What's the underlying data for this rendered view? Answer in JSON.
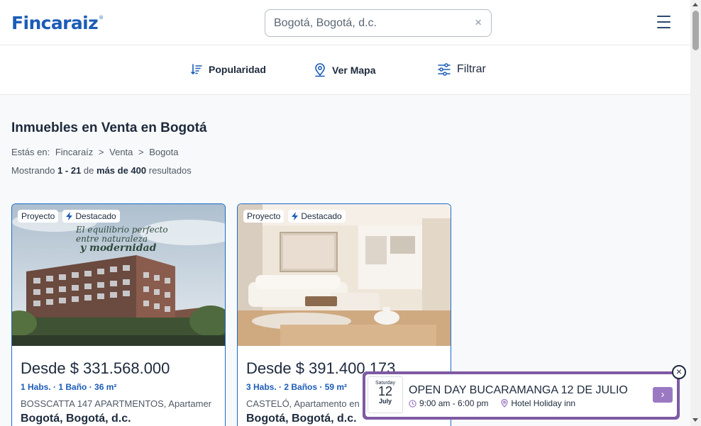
{
  "header": {
    "logo": "Fincaraiz",
    "logo_mark": "®",
    "search_value": "Bogotá, Bogotá, d.c.",
    "clear_glyph": "×"
  },
  "toolbar": {
    "popularity": "Popularidad",
    "map": "Ver Mapa",
    "filter": "Filtrar"
  },
  "main": {
    "title": "Inmuebles en Venta en Bogotá",
    "breadcrumb": {
      "prefix": "Estás en:",
      "items": [
        "Fincaraíz",
        ">",
        "Venta",
        ">",
        "Bogota"
      ]
    },
    "results": {
      "prefix": "Mostrando",
      "range": "1 - 21",
      "middle": "de",
      "total": "más de 400",
      "suffix": "resultados"
    }
  },
  "listings": [
    {
      "badge_project": "Proyecto",
      "badge_featured": "Destacado",
      "image_caption_1": "El equilibrio perfecto",
      "image_caption_2": "entre naturaleza",
      "image_caption_3": "y modernidad",
      "price": "Desde $ 331.568.000",
      "specs": "1 Habs. · 1 Baño · 36 m²",
      "description": "BOSSCATTA 147 APARTMENTOS, Apartamer",
      "location": "Bogotá, Bogotá, d.c."
    },
    {
      "badge_project": "Proyecto",
      "badge_featured": "Destacado",
      "price": "Desde $ 391.400.173",
      "specs": "3 Habs. · 2 Baños · 59 m²",
      "description": "CASTELÓ, Apartamento en",
      "location": "Bogotá, Bogotá, d.c."
    }
  ],
  "promo": {
    "day": "Saturday",
    "date": "12",
    "month": "July",
    "title": "OPEN DAY BUCARAMANGA 12 DE JULIO",
    "time": "9:00 am - 6:00 pm",
    "venue": "Hotel Holiday inn",
    "arrow": "›",
    "close": "×",
    "accent": "#7e5aa3"
  },
  "colors": {
    "brand": "#1c5cb8",
    "card_border": "#1c6cc9",
    "text": "#1d2a3d"
  }
}
